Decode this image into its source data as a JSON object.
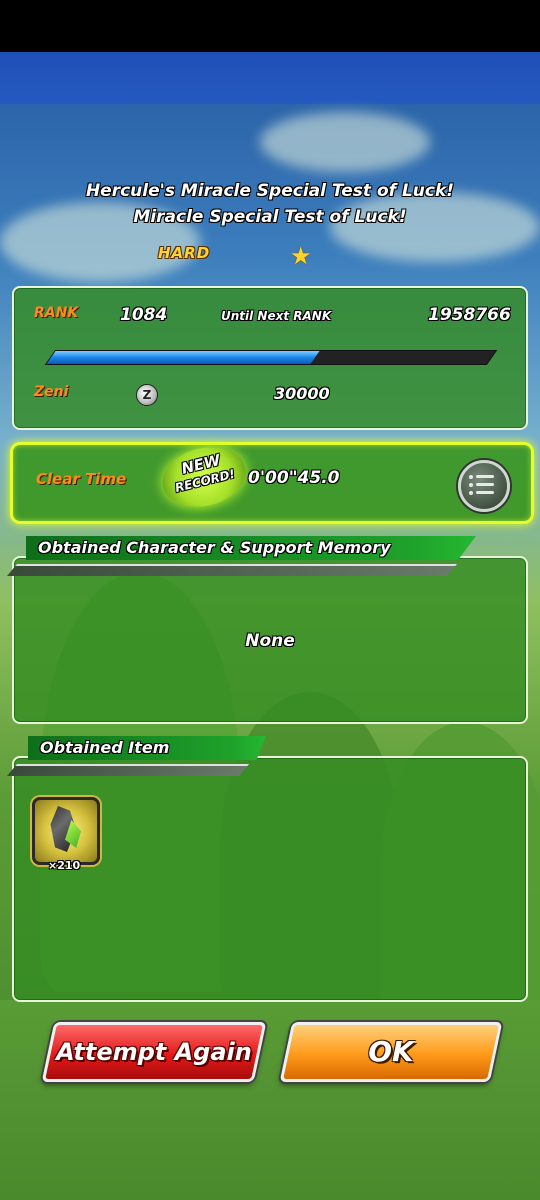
{
  "header": {
    "title_line1": "Hercule's Miracle Special Test of Luck!",
    "title_line2": "Miracle Special Test of Luck!",
    "difficulty": "HARD"
  },
  "stats": {
    "rank_label": "RANK",
    "rank_value": "1084",
    "until_next_label": "Until Next RANK",
    "until_next_value": "1958766",
    "rank_progress": 0.6,
    "zeni_label": "Zeni",
    "zeni_value": "30000"
  },
  "clear_time": {
    "label": "Clear Time",
    "badge_line1": "NEW",
    "badge_line2": "RECORD!",
    "value": "0'00\"45.0"
  },
  "obtained_character": {
    "header": "Obtained Character & Support Memory",
    "content": "None"
  },
  "obtained_item": {
    "header": "Obtained Item",
    "items": [
      {
        "icon": "awakening-medal-icon",
        "quantity": "×210"
      }
    ]
  },
  "buttons": {
    "attempt_again": "Attempt Again",
    "ok": "OK"
  },
  "colors": {
    "panel_green": "#348c22",
    "highlight_yellow": "#e6ff2a",
    "rank_bar_blue": "#1b84e8",
    "label_orange": "#ff8a1a",
    "button_red": "#e41a1a",
    "button_orange": "#ff9a1a"
  }
}
